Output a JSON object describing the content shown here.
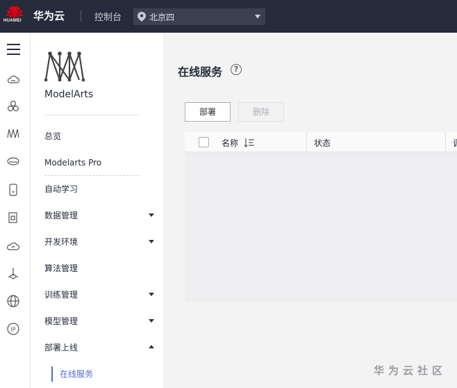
{
  "topbar": {
    "logo_text": "HUAWEI",
    "brand": "华为云",
    "console": "控制台",
    "region": "北京四"
  },
  "rail": {
    "icons": [
      "menu-icon",
      "cloud-server-icon",
      "cluster-icon",
      "modelarts-icon",
      "database-icon",
      "phone-icon",
      "document-icon",
      "cloud-icon",
      "network-icon",
      "globe-icon",
      "ip-icon"
    ]
  },
  "sidenav": {
    "service_title": "ModelArts",
    "items": [
      {
        "label": "总览"
      },
      {
        "label": "Modelarts Pro"
      },
      {
        "label": "自动学习"
      },
      {
        "label": "数据管理"
      },
      {
        "label": "开发环境"
      },
      {
        "label": "算法管理"
      },
      {
        "label": "训练管理"
      },
      {
        "label": "模型管理"
      },
      {
        "label": "部署上线"
      }
    ],
    "sub_item": "在线服务"
  },
  "main": {
    "title": "在线服务",
    "help": "?",
    "deploy_label": "部署",
    "delete_label": "删除",
    "columns": {
      "name": "名称",
      "status": "状态",
      "partial": "调"
    }
  },
  "watermark": "华为云社区",
  "colors": {
    "topbar": "#252b3a",
    "accent": "#526ecc",
    "logo_red": "#e60012"
  }
}
